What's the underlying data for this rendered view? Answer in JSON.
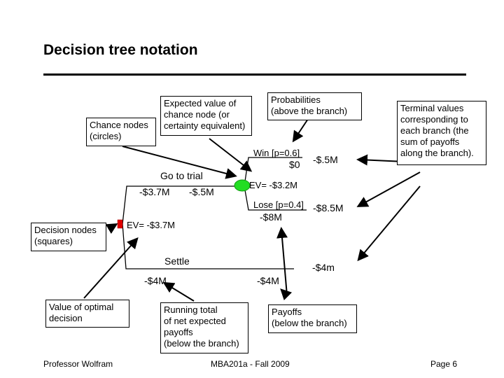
{
  "slide": {
    "title": "Decision tree notation",
    "footer": {
      "author": "Professor Wolfram",
      "course": "MBA201a - Fall 2009",
      "page": "Page 6"
    }
  },
  "callouts": {
    "chance_nodes": [
      "Chance nodes",
      "(circles)"
    ],
    "expected_value": [
      "Expected value of",
      "chance node (or",
      "certainty equivalent)"
    ],
    "probabilities": [
      "Probabilities",
      "(above the branch)"
    ],
    "terminal_values": [
      "Terminal values",
      "corresponding to",
      "each branch (the",
      "sum of payoffs",
      "along the branch)."
    ],
    "decision_nodes": [
      "Decision nodes",
      "(squares)"
    ],
    "optimal_value": [
      "Value of optimal",
      "decision"
    ],
    "running_total": [
      "Running total",
      "of net expected",
      "payoffs",
      "(below the branch)"
    ],
    "payoffs": [
      "Payoffs",
      "(below the branch)"
    ]
  },
  "tree": {
    "decision_node": {
      "shape": "square",
      "color": "#e00000",
      "ev_label": "EV= -$3.7M"
    },
    "go_to_trial": {
      "label": "Go to trial",
      "running_total": "-$3.7M",
      "payoff": "-$.5M",
      "chance_node": {
        "shape": "circle",
        "color": "#22dd22",
        "ev_label": "EV= -$3.2M"
      },
      "win": {
        "label": "Win [p=0.6]",
        "payoff": "$0",
        "terminal": "-$.5M"
      },
      "lose": {
        "label": "Lose [p=0.4]",
        "payoff": "-$8M",
        "terminal": "-$8.5M"
      }
    },
    "settle": {
      "label": "Settle",
      "running_total": "-$4M",
      "payoff": "-$4M",
      "terminal": "-$4m"
    }
  }
}
